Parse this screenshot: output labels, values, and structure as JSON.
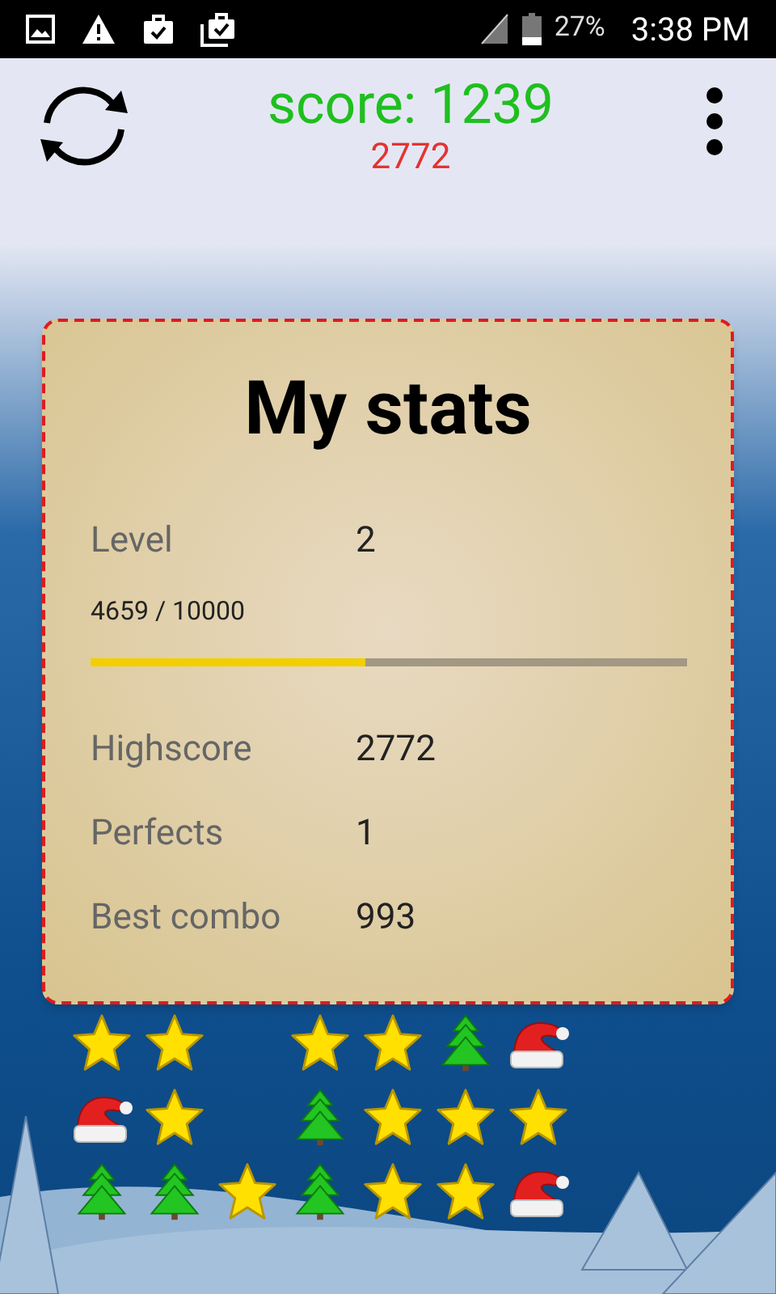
{
  "status_bar": {
    "battery": "27%",
    "time": "3:38 PM"
  },
  "header": {
    "score": "score: 1239",
    "best": "2772"
  },
  "stats": {
    "title": "My stats",
    "level_label": "Level",
    "level_value": "2",
    "progress_text": "4659 / 10000",
    "progress": {
      "level": 0.46
    },
    "rows": [
      {
        "label": "Highscore",
        "value": "2772"
      },
      {
        "label": "Perfects",
        "value": "1"
      },
      {
        "label": "Best combo",
        "value": "993"
      }
    ]
  },
  "board": [
    [
      {
        "kind": "star"
      },
      {
        "kind": "star"
      },
      {
        "kind": "empty"
      },
      {
        "kind": "star"
      },
      {
        "kind": "star"
      },
      {
        "kind": "tree"
      },
      {
        "kind": "hat"
      }
    ],
    [
      {
        "kind": "hat"
      },
      {
        "kind": "star"
      },
      {
        "kind": "empty"
      },
      {
        "kind": "tree"
      },
      {
        "kind": "star"
      },
      {
        "kind": "star"
      },
      {
        "kind": "star"
      }
    ],
    [
      {
        "kind": "tree"
      },
      {
        "kind": "tree"
      },
      {
        "kind": "star"
      },
      {
        "kind": "tree"
      },
      {
        "kind": "star"
      },
      {
        "kind": "star"
      },
      {
        "kind": "hat"
      }
    ]
  ]
}
